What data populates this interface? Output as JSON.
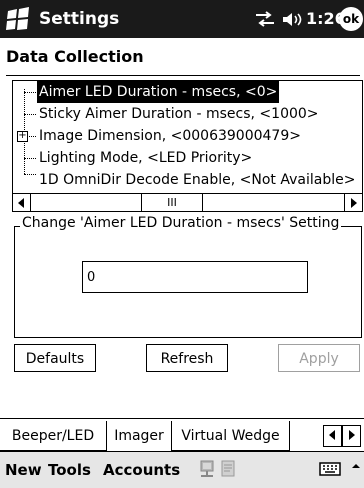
{
  "titlebar": {
    "title": "Settings",
    "time": "1:26",
    "ok_label": "ok"
  },
  "heading": "Data Collection",
  "tree": {
    "items": [
      {
        "label": "Aimer LED Duration - msecs, <0>",
        "selected": true
      },
      {
        "label": "Sticky Aimer Duration - msecs, <1000>"
      },
      {
        "label": "Image Dimension, <000639000479>",
        "expander": "+"
      },
      {
        "label": "Lighting Mode, <LED Priority>"
      },
      {
        "label": "1D OmniDir Decode Enable, <Not Available>"
      }
    ]
  },
  "scrollbar": {
    "thumb_glyph": "III"
  },
  "setting_group": {
    "legend": "Change 'Aimer LED Duration - msecs' Setting",
    "value": "0"
  },
  "buttons": {
    "defaults": "Defaults",
    "refresh": "Refresh",
    "apply": "Apply"
  },
  "tabs": [
    "Beeper/LED",
    "Imager",
    "Virtual Wedge"
  ],
  "active_tab": "Imager",
  "menubar": {
    "new": "New",
    "tools": "Tools",
    "accounts": "Accounts"
  },
  "icons": [
    "windows-start-icon",
    "connectivity-icon",
    "speaker-icon",
    "ok-icon",
    "network-icon",
    "document-icon",
    "keyboard-icon",
    "input-arrow-icon"
  ]
}
